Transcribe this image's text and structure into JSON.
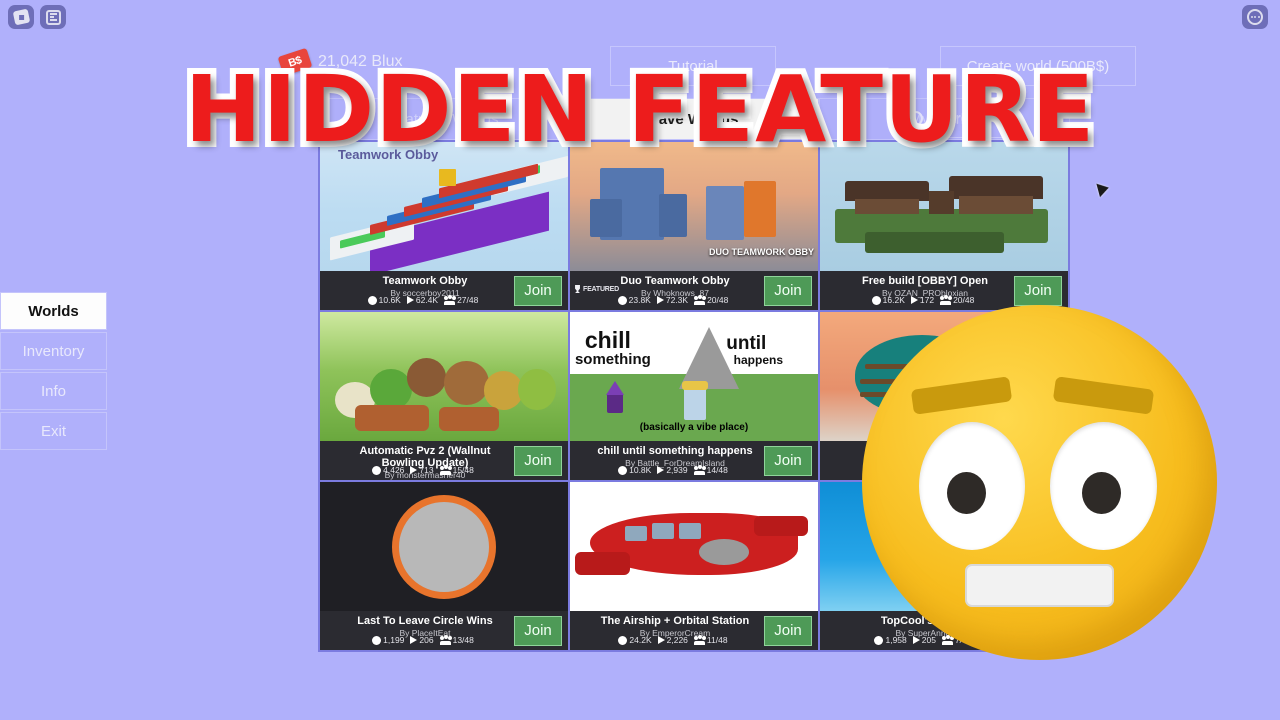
{
  "topbar": {
    "icons": [
      {
        "name": "roblox-home-icon"
      },
      {
        "name": "roblox-menu-icon"
      },
      {
        "name": "chat-bubble-icon"
      }
    ]
  },
  "currency": {
    "tag_label": "B$",
    "amount": "21,042 Blux"
  },
  "top_buttons": {
    "tutorial": "Tutorial",
    "create_world": "Create world (500B$)"
  },
  "tabs": [
    {
      "label": "Featured Worlds",
      "active": false
    },
    {
      "label": "Fave Worlds",
      "active": true
    },
    {
      "label": "My Worlds",
      "active": false
    }
  ],
  "search": {
    "placeholder": "Search",
    "value": ""
  },
  "sidebar": {
    "items": [
      {
        "label": "Worlds",
        "active": true
      },
      {
        "label": "Inventory",
        "active": false
      },
      {
        "label": "Info",
        "active": false
      },
      {
        "label": "Exit",
        "active": false
      }
    ]
  },
  "overlay": {
    "headline": "HIDDEN FEATURE"
  },
  "cards": [
    {
      "title": "Teamwork Obby",
      "author": "By soccerboy2011",
      "likes": "10.6K",
      "visits": "62.4K",
      "players": "27/48",
      "join_label": "Join",
      "featured": false,
      "thumb_caption": "Teamwork Obby"
    },
    {
      "title": "Duo Teamwork Obby",
      "author": "By Whoknows_87",
      "likes": "23.8K",
      "visits": "72.3K",
      "players": "20/48",
      "join_label": "Join",
      "featured": true,
      "featured_label": "FEATURED",
      "thumb_caption": "DUO TEAMWORK OBBY"
    },
    {
      "title": "Free build [OBBY] Open",
      "author": "By OZAN_PRObloxian",
      "likes": "16.2K",
      "visits": "172",
      "players": "20/48",
      "join_label": "Join",
      "featured": false,
      "thumb_caption": ""
    },
    {
      "title": "Automatic Pvz 2 (Wallnut Bowling Update)",
      "author": "By monstermasher40",
      "likes": "4,426",
      "visits": "713",
      "players": "15/48",
      "join_label": "Join",
      "featured": false,
      "thumb_caption": ""
    },
    {
      "title": "chill until something happens",
      "author": "By Battle_ForDreamIsland",
      "likes": "10.8K",
      "visits": "2,939",
      "players": "14/48",
      "join_label": "Join",
      "featured": false,
      "thumb_caption": "chill until something happens",
      "thumb_sub": "(basically a vibe place)"
    },
    {
      "title": "",
      "author": "",
      "likes": "",
      "visits": "",
      "players": "",
      "join_label": "",
      "featured": false,
      "thumb_caption": ""
    },
    {
      "title": "Last To Leave Circle Wins",
      "author": "By PlaceItEat",
      "likes": "1,199",
      "visits": "206",
      "players": "13/48",
      "join_label": "Join",
      "featured": false,
      "thumb_caption": ""
    },
    {
      "title": "The Airship + Orbital Station",
      "author": "By EmperorCream",
      "likes": "24.2K",
      "visits": "2,226",
      "players": "11/48",
      "join_label": "Join",
      "featured": false,
      "thumb_caption": ""
    },
    {
      "title": "TopCool's A Mon",
      "author": "By SuperAnnoy",
      "likes": "1,958",
      "visits": "205",
      "players": "7/48",
      "join_label": "",
      "featured": false,
      "thumb_caption": ""
    }
  ],
  "chill_words": {
    "w1": "chill",
    "w2": "until",
    "w3": "something",
    "w4": "happens"
  },
  "colors": {
    "background": "#b0b0fb",
    "card_bg": "#2b2b31",
    "join_green": "#4e9a57",
    "overlay_red": "#ed1c1c",
    "blux_tag": "#e8453c"
  }
}
